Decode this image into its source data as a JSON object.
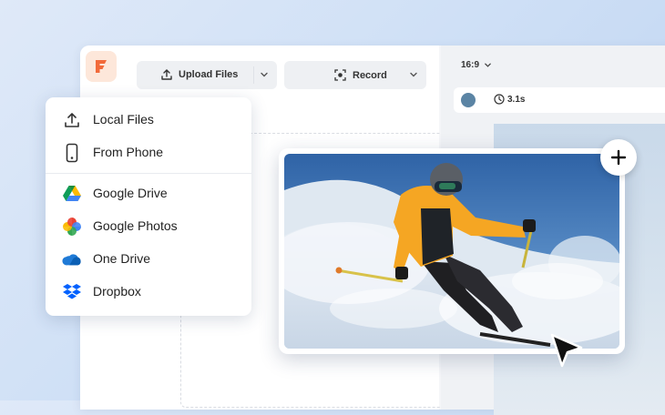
{
  "toolbar": {
    "upload_label": "Upload Files",
    "record_label": "Record"
  },
  "preview": {
    "aspect_ratio": "16:9",
    "duration": "3.1s"
  },
  "upload_menu": {
    "items": [
      {
        "label": "Local Files",
        "icon": "upload-icon"
      },
      {
        "label": "From Phone",
        "icon": "phone-icon"
      },
      {
        "label": "Google Drive",
        "icon": "google-drive-icon"
      },
      {
        "label": "Google Photos",
        "icon": "google-photos-icon"
      },
      {
        "label": "One Drive",
        "icon": "onedrive-icon"
      },
      {
        "label": "Dropbox",
        "icon": "dropbox-icon"
      }
    ]
  },
  "colors": {
    "brand": "#f26a3a",
    "accent_dot": "#5b84a4",
    "dropbox": "#0061fe",
    "onedrive": "#0f6cbd"
  }
}
